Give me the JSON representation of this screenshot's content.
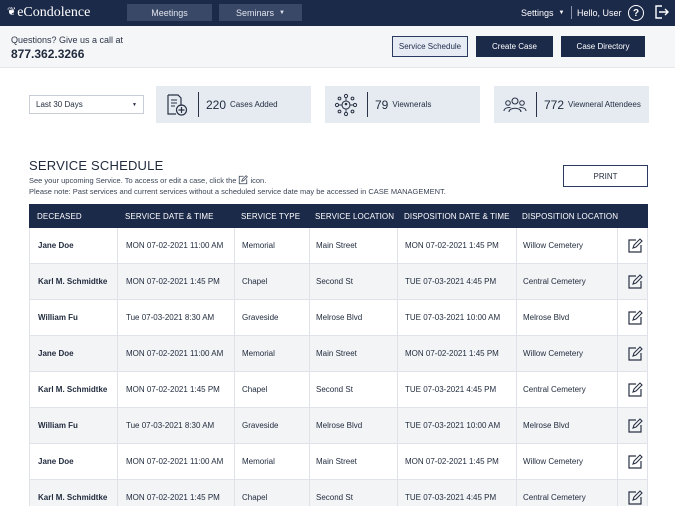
{
  "app": {
    "logo": "eCondolence",
    "nav": {
      "meetings": "Meetings",
      "seminars": "Seminars"
    },
    "settings": "Settings",
    "user_greeting": "Hello, User",
    "help": "?"
  },
  "header": {
    "questions": "Questions? Give us a call at",
    "phone": "877.362.3266",
    "buttons": {
      "service_schedule": "Service Schedule",
      "create_case": "Create Case",
      "case_directory": "Case Directory"
    }
  },
  "filters": {
    "date_range": "Last 30 Days"
  },
  "stats": [
    {
      "value": "220",
      "label": "Cases Added",
      "icon": "document-add-icon"
    },
    {
      "value": "79",
      "label": "Viewnerals",
      "icon": "network-people-icon"
    },
    {
      "value": "772",
      "label": "Viewneral Attendees",
      "icon": "group-icon"
    }
  ],
  "schedule": {
    "title": "SERVICE SCHEDULE",
    "note1_before": "See your upcoming Service. To access or edit a case, click the",
    "note1_after": "icon.",
    "note2": "Please note: Past services and current services without a scheduled service date may be accessed in CASE MANAGEMENT.",
    "print": "PRINT",
    "columns": [
      "DECEASED",
      "SERVICE DATE & TIME",
      "SERVICE TYPE",
      "SERVICE LOCATION",
      "DISPOSITION DATE & TIME",
      "DISPOSITION LOCATION"
    ],
    "rows": [
      [
        "Jane Doe",
        "MON 07-02-2021 11:00 AM",
        "Memorial",
        "Main Street",
        "MON 07-02-2021 1:45 PM",
        "Willow Cemetery"
      ],
      [
        "Karl M. Schmidtke",
        "MON 07-02-2021 1:45 PM",
        "Chapel",
        "Second St",
        "TUE 07-03-2021 4:45 PM",
        "Central Cemetery"
      ],
      [
        "William Fu",
        "Tue 07-03-2021 8:30 AM",
        "Graveside",
        "Melrose Blvd",
        "TUE 07-03-2021 10:00 AM",
        "Melrose Blvd"
      ],
      [
        "Jane Doe",
        "MON 07-02-2021 11:00 AM",
        "Memorial",
        "Main Street",
        "MON 07-02-2021 1:45 PM",
        "Willow Cemetery"
      ],
      [
        "Karl M. Schmidtke",
        "MON 07-02-2021 1:45 PM",
        "Chapel",
        "Second St",
        "TUE 07-03-2021 4:45 PM",
        "Central Cemetery"
      ],
      [
        "William Fu",
        "Tue 07-03-2021 8:30 AM",
        "Graveside",
        "Melrose Blvd",
        "TUE 07-03-2021 10:00 AM",
        "Melrose Blvd"
      ],
      [
        "Jane Doe",
        "MON 07-02-2021 11:00 AM",
        "Memorial",
        "Main Street",
        "MON 07-02-2021 1:45 PM",
        "Willow Cemetery"
      ],
      [
        "Karl M. Schmidtke",
        "MON 07-02-2021 1:45 PM",
        "Chapel",
        "Second St",
        "TUE 07-03-2021 4:45 PM",
        "Central Cemetery"
      ]
    ]
  },
  "colors": {
    "navy": "#1c2a4a",
    "stat_bg": "#e6ebf2",
    "row_alt": "#f3f4f6"
  }
}
